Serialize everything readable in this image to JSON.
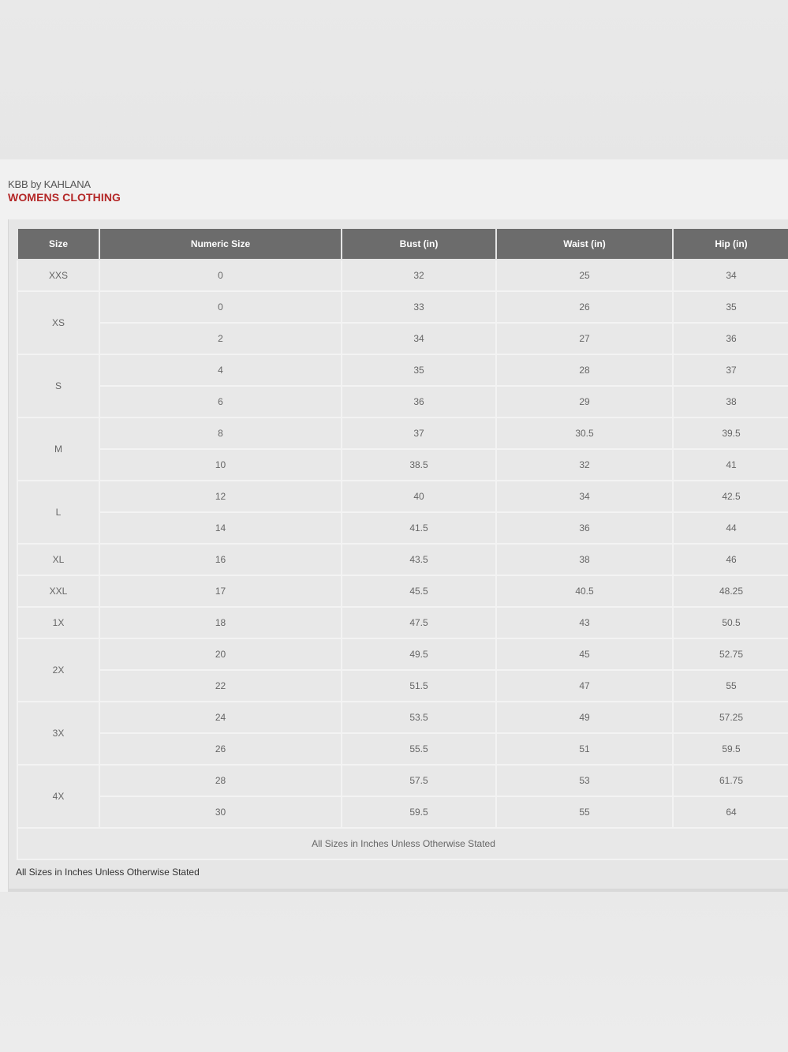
{
  "brand": "KBB by KAHLANA",
  "subtitle": "WOMENS CLOTHING",
  "columns": [
    "Size",
    "Numeric Size",
    "Bust (in)",
    "Waist (in)",
    "Hip (in)"
  ],
  "groups": [
    {
      "size": "XXS",
      "rows": [
        [
          "0",
          "32",
          "25",
          "34"
        ]
      ]
    },
    {
      "size": "XS",
      "rows": [
        [
          "0",
          "33",
          "26",
          "35"
        ],
        [
          "2",
          "34",
          "27",
          "36"
        ]
      ]
    },
    {
      "size": "S",
      "rows": [
        [
          "4",
          "35",
          "28",
          "37"
        ],
        [
          "6",
          "36",
          "29",
          "38"
        ]
      ]
    },
    {
      "size": "M",
      "rows": [
        [
          "8",
          "37",
          "30.5",
          "39.5"
        ],
        [
          "10",
          "38.5",
          "32",
          "41"
        ]
      ]
    },
    {
      "size": "L",
      "rows": [
        [
          "12",
          "40",
          "34",
          "42.5"
        ],
        [
          "14",
          "41.5",
          "36",
          "44"
        ]
      ]
    },
    {
      "size": "XL",
      "rows": [
        [
          "16",
          "43.5",
          "38",
          "46"
        ]
      ]
    },
    {
      "size": "XXL",
      "rows": [
        [
          "17",
          "45.5",
          "40.5",
          "48.25"
        ]
      ]
    },
    {
      "size": "1X",
      "rows": [
        [
          "18",
          "47.5",
          "43",
          "50.5"
        ]
      ]
    },
    {
      "size": "2X",
      "rows": [
        [
          "20",
          "49.5",
          "45",
          "52.75"
        ],
        [
          "22",
          "51.5",
          "47",
          "55"
        ]
      ]
    },
    {
      "size": "3X",
      "rows": [
        [
          "24",
          "53.5",
          "49",
          "57.25"
        ],
        [
          "26",
          "55.5",
          "51",
          "59.5"
        ]
      ]
    },
    {
      "size": "4X",
      "rows": [
        [
          "28",
          "57.5",
          "53",
          "61.75"
        ],
        [
          "30",
          "59.5",
          "55",
          "64"
        ]
      ]
    }
  ],
  "table_footnote": "All Sizes in Inches Unless Otherwise Stated",
  "page_footnote": "All Sizes in Inches Unless Otherwise Stated",
  "colors": {
    "header_bg": "#6c6c6c",
    "accent_red": "#b42828",
    "cell_bg": "#e8e8e8"
  }
}
